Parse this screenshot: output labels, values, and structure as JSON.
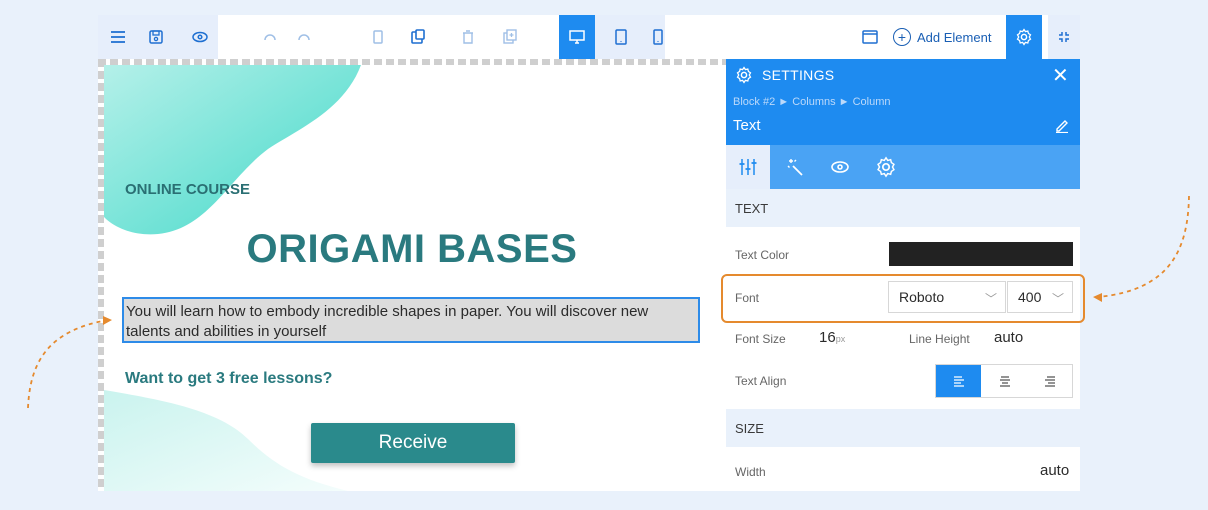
{
  "toolbar": {
    "add_element_label": "Add Element"
  },
  "canvas": {
    "kicker": "ONLINE COURSE",
    "title": "ORIGAMI BASES",
    "description": "You will learn how to embody incredible shapes in paper. You will discover new talents and abilities in yourself",
    "lessons": "Want to get 3 free lessons?",
    "button": "Receive"
  },
  "settings": {
    "title": "SETTINGS",
    "breadcrumb": "Block #2 ► Columns ► Column",
    "element_name": "Text",
    "section_text": "TEXT",
    "text_color_label": "Text Color",
    "font_label": "Font",
    "font_value": "Roboto",
    "weight_value": "400",
    "font_size_label": "Font Size",
    "font_size_value": "16",
    "font_size_unit": "px",
    "line_height_label": "Line Height",
    "line_height_value": "auto",
    "text_align_label": "Text Align",
    "section_size": "SIZE",
    "width_label": "Width",
    "width_value": "auto"
  },
  "colors": {
    "accent": "#1e8bf0",
    "teal": "#2a8a8c",
    "highlight": "#e58a2e",
    "text_color_swatch": "#222222"
  }
}
